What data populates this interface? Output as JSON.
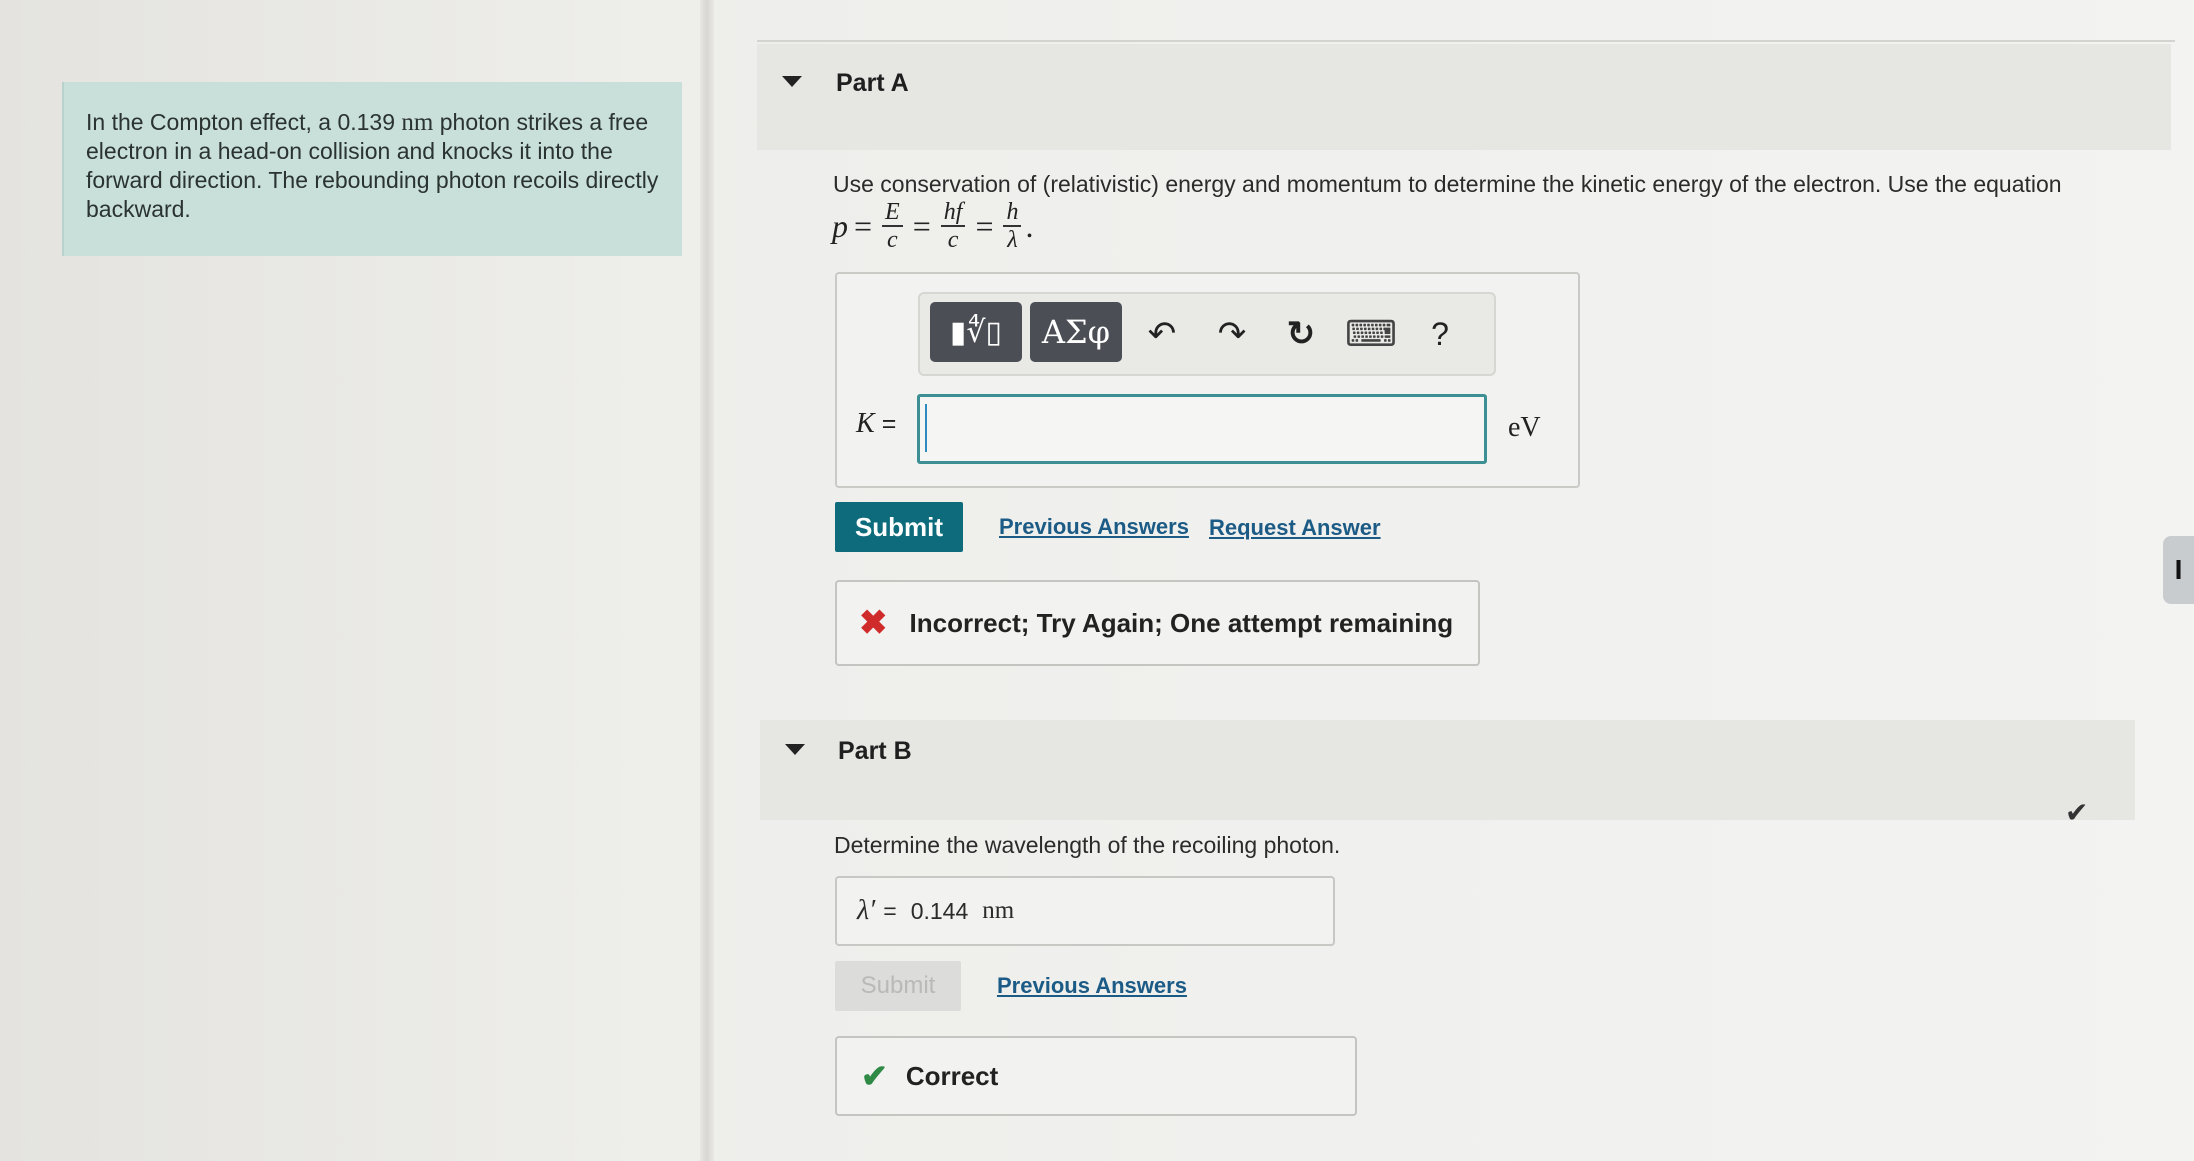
{
  "problem": {
    "text_before": "In the Compton effect, a 0.139 ",
    "unit": "nm",
    "text_after": " photon strikes a free electron in a head-on collision and knocks it into the forward direction. The rebounding photon recoils directly backward."
  },
  "part_a": {
    "title": "Part A",
    "question": "Use conservation of (relativistic) energy and momentum to determine the kinetic energy of the electron. Use the equation",
    "equation": {
      "p": "p",
      "eq": "=",
      "f1_num": "E",
      "f1_den": "c",
      "f2_num": "hf",
      "f2_den": "c",
      "f3_num": "h",
      "f3_den": "λ",
      "end": "."
    },
    "toolbar": {
      "template_label": "▮∜▯",
      "greek_label": "ΑΣφ",
      "undo": "↶",
      "redo": "↷",
      "reset": "↻",
      "keyboard": "⌨",
      "help": "?"
    },
    "answer_label": "K",
    "answer_eq": "=",
    "answer_value": "",
    "answer_unit": "eV",
    "submit_label": "Submit",
    "previous_answers": "Previous Answers",
    "request_answer": "Request Answer",
    "feedback_icon": "✖",
    "feedback": "Incorrect; Try Again; One attempt remaining"
  },
  "part_b": {
    "title": "Part B",
    "question": "Determine the wavelength of the recoiling photon.",
    "answer_label": "λ′",
    "answer_eq": "=",
    "answer_value": "0.144",
    "answer_unit": "nm",
    "submit_label": "Submit",
    "previous_answers": "Previous Answers",
    "feedback_icon": "✔",
    "feedback": "Correct"
  },
  "side_tab": "I",
  "side_check": "✔",
  "colors": {
    "accent": "#0e6b7c",
    "link": "#1b5b86",
    "error": "#d02b2b",
    "success": "#2f8a45",
    "problem_bg": "#c9dfd9"
  }
}
